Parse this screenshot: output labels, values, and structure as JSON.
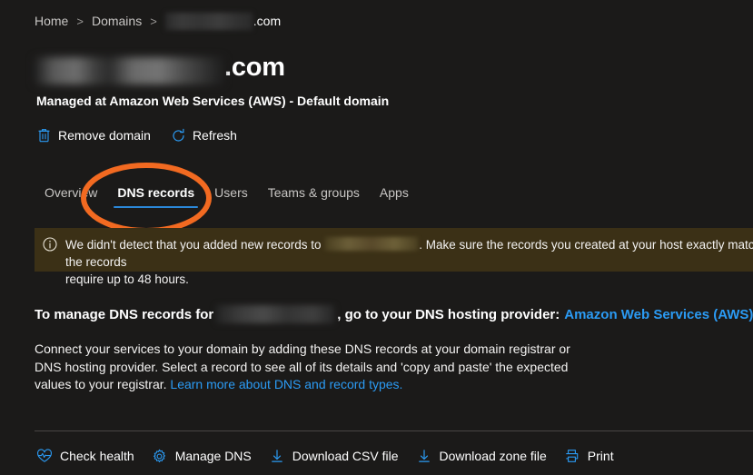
{
  "theme": {
    "background": "#1b1a19",
    "accent_blue": "#2b88d8",
    "link_blue": "#2b9bf4",
    "banner_background": "#3b3016",
    "annotation_orange": "#f26a21",
    "divider": "#484644"
  },
  "breadcrumb": {
    "home": "Home",
    "domains": "Domains",
    "separator": ">",
    "current_redacted": true,
    "current_suffix": ".com"
  },
  "header": {
    "title_redacted": true,
    "title_suffix": ".com",
    "subtitle": "Managed at Amazon Web Services (AWS) - Default domain"
  },
  "command_bar": {
    "items": [
      {
        "label": "Remove domain",
        "icon": "trash-icon"
      },
      {
        "label": "Refresh",
        "icon": "refresh-icon"
      }
    ]
  },
  "tabs": {
    "items": [
      {
        "label": "Overview",
        "selected": false
      },
      {
        "label": "DNS records",
        "selected": true
      },
      {
        "label": "Users",
        "selected": false
      },
      {
        "label": "Teams & groups",
        "selected": false
      },
      {
        "label": "Apps",
        "selected": false
      }
    ]
  },
  "annotation": {
    "shape": "ellipse",
    "color": "#f26a21",
    "targets": "DNS records"
  },
  "banner": {
    "icon": "info-icon",
    "text_before": "We didn't detect that you added new records to",
    "redacted_domain": true,
    "text_after": ". Make sure the records you created at your host exactly match the records",
    "line2": "require up to 48 hours."
  },
  "manage_line": {
    "text_before": "To manage DNS records for",
    "redacted_domain": true,
    "text_middle": ", go to your DNS hosting provider:",
    "provider_link": "Amazon Web Services (AWS).",
    "edit_icon": "pencil-icon"
  },
  "description": {
    "text": "Connect your services to your domain by adding these DNS records at your domain registrar or DNS hosting provider. Select a record to see all of its details and 'copy and paste' the expected values to your registrar.",
    "link": "Learn more about DNS and record types."
  },
  "bottom_bar": {
    "items": [
      {
        "label": "Check health",
        "icon": "heart-pulse-icon"
      },
      {
        "label": "Manage DNS",
        "icon": "gear-icon"
      },
      {
        "label": "Download CSV file",
        "icon": "download-icon"
      },
      {
        "label": "Download zone file",
        "icon": "download-icon"
      },
      {
        "label": "Print",
        "icon": "printer-icon"
      }
    ]
  }
}
